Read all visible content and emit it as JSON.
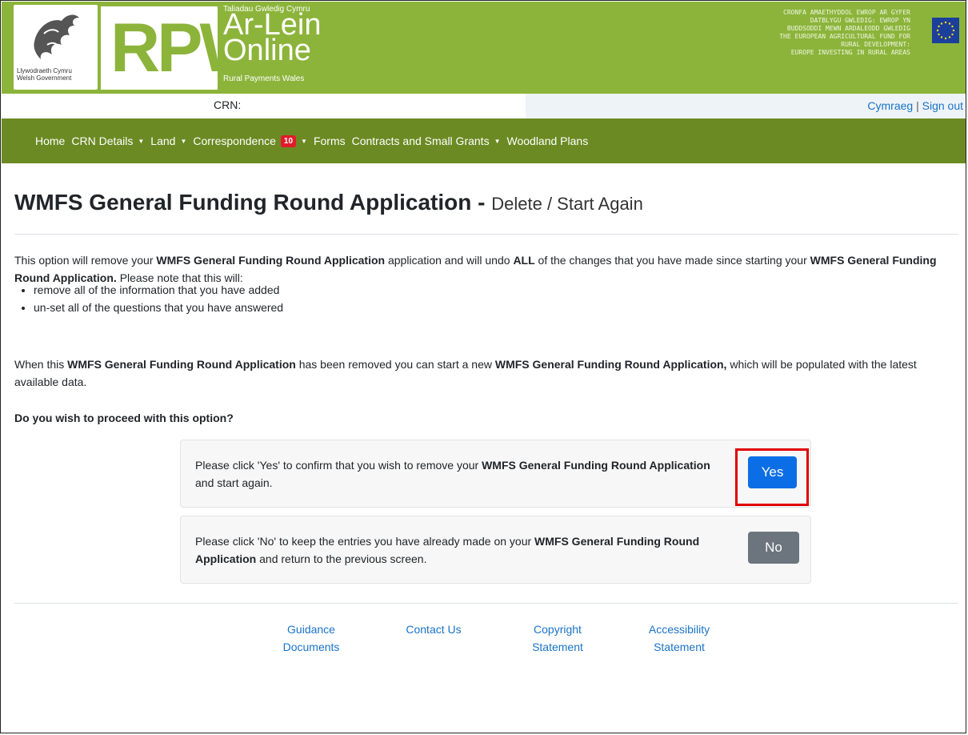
{
  "header": {
    "gov_logo_line1": "Llywodraeth Cymru",
    "gov_logo_line2": "Welsh Government",
    "rpw": "RPW",
    "small_top": "Taliadau Gwledig Cymru",
    "big_line1": "Ar-Lein",
    "big_line2": "Online",
    "small_bottom": "Rural Payments Wales",
    "eu_lines": [
      "CRONFA AMAETHYDDOL EWROP AR GYFER",
      "DATBLYGU GWLEDIG: EWROP YN",
      "BUDDSODDI MEWN ARDALEODD GWLEDIG",
      "THE EUROPEAN AGRICULTURAL FUND FOR",
      "RURAL DEVELOPMENT:",
      "EUROPE INVESTING IN RURAL AREAS"
    ]
  },
  "crnbar": {
    "crn_label": "CRN:",
    "cymraeg": "Cymraeg",
    "separator": " | ",
    "sign_out": "Sign out"
  },
  "nav": {
    "home": "Home",
    "crn_details": "CRN Details",
    "land": "Land",
    "correspondence": "Correspondence",
    "correspondence_badge": "10",
    "forms": "Forms",
    "contracts": "Contracts and Small Grants",
    "woodland": "Woodland Plans"
  },
  "page": {
    "title": "WMFS General Funding Round Application - ",
    "subtitle": "Delete / Start Again",
    "intro": {
      "t1": "This option will remove your ",
      "b1": "WMFS General Funding Round Application",
      "t2": " application and will undo ",
      "b2": "ALL",
      "t3": " of the changes that you have made since starting your ",
      "b3": "WMFS General Funding Round Application.",
      "t4": " Please note that this will:"
    },
    "bullets": [
      "remove all of the information that you have added",
      "un-set all of the questions that you have answered"
    ],
    "removed": {
      "t1": "When this ",
      "b1": "WMFS General Funding Round Application",
      "t2": " has been removed you can start a new ",
      "b2": "WMFS General Funding Round Application,",
      "t3": " which will be populated with the latest available data."
    },
    "question": "Do you wish to proceed with this option?",
    "yes_box": {
      "t1": "Please click 'Yes' to confirm that you wish to remove your ",
      "b1": "WMFS General Funding Round Application",
      "t2": " and start again.",
      "button": "Yes"
    },
    "no_box": {
      "t1": "Please click 'No' to keep the entries you have already made on your ",
      "b1": "WMFS General Funding Round Application",
      "t2": " and return to the previous screen.",
      "button": "No"
    }
  },
  "footer": {
    "guidance": "Guidance Documents",
    "contact": "Contact Us",
    "copyright": "Copyright Statement",
    "accessibility": "Accessibility Statement"
  },
  "colors": {
    "header_green": "#8cb43b",
    "nav_green": "#6b8a23",
    "primary_blue": "#0b6ee6",
    "secondary_gray": "#6c757d",
    "highlight_red": "#e00000",
    "badge_red": "#e21b2b"
  }
}
